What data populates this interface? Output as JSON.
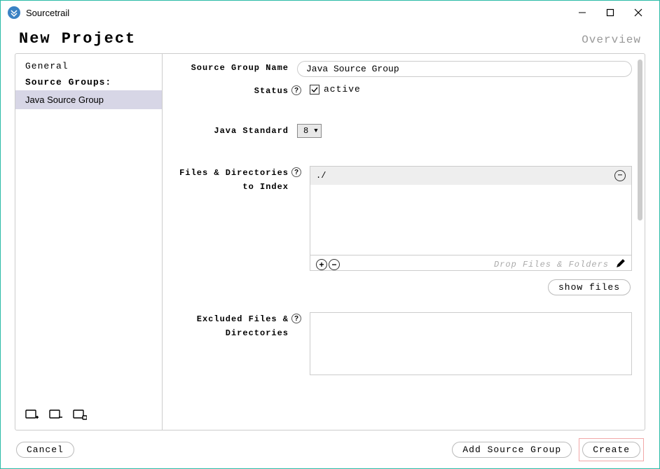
{
  "titlebar": {
    "app_name": "Sourcetrail"
  },
  "header": {
    "title": "New Project",
    "overview": "Overview"
  },
  "sidebar": {
    "general": "General",
    "source_groups_label": "Source Groups:",
    "items": [
      "Java Source Group"
    ]
  },
  "form": {
    "name_label": "Source Group Name",
    "name_value": "Java Source Group",
    "status_label": "Status",
    "status_active": "active",
    "java_std_label": "Java Standard",
    "java_std_value": "8",
    "files_label_l1": "Files & Directories",
    "files_label_l2": "to Index",
    "files_item": "./",
    "drop_hint": "Drop Files & Folders",
    "show_files": "show files",
    "excluded_label_l1": "Excluded Files &",
    "excluded_label_l2": "Directories"
  },
  "buttons": {
    "cancel": "Cancel",
    "add_sg": "Add Source Group",
    "create": "Create"
  }
}
